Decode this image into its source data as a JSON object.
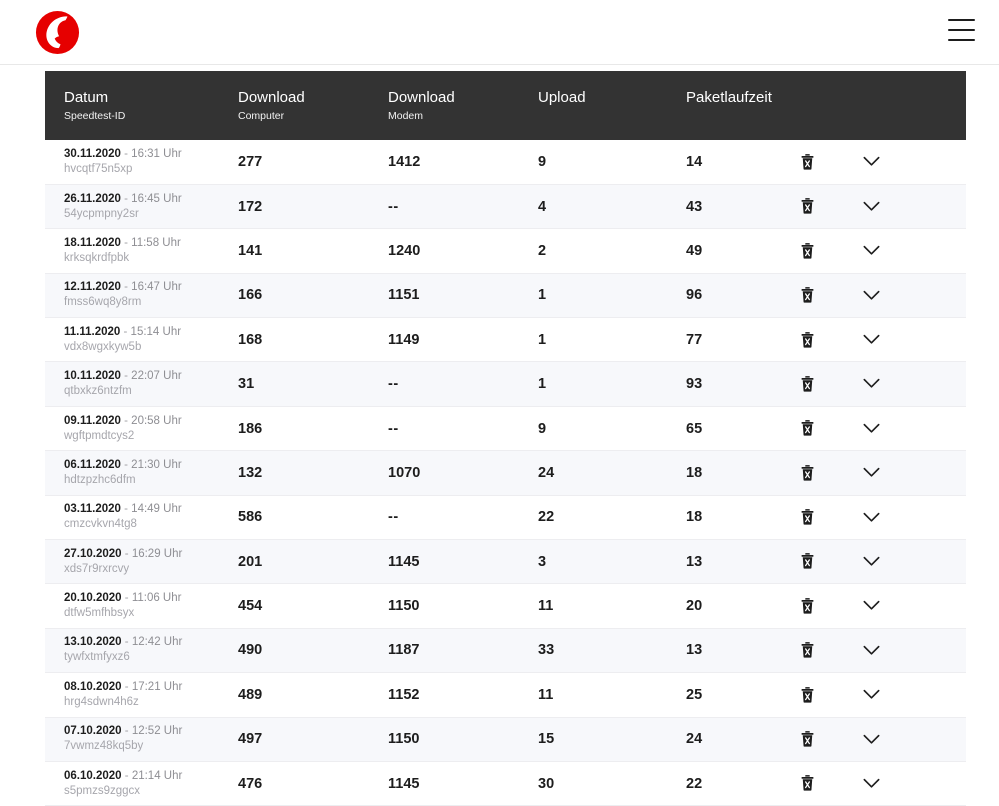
{
  "header": {
    "logo_name": "vodafone-logo",
    "logo_color": "#e60000",
    "menu_label": "menu"
  },
  "table": {
    "columns": [
      {
        "title": "Datum",
        "sub": "Speedtest-ID"
      },
      {
        "title": "Download",
        "sub": "Computer"
      },
      {
        "title": "Download",
        "sub": "Modem"
      },
      {
        "title": "Upload",
        "sub": ""
      },
      {
        "title": "Paketlaufzeit",
        "sub": ""
      },
      {
        "title": "",
        "sub": ""
      }
    ],
    "header_bg": "#333333",
    "row_alt_bg": "#f7f8fb",
    "rows": [
      {
        "date": "30.11.2020",
        "sep": "-",
        "time": "16:31 Uhr",
        "id": "hvcqtf75n5xp",
        "download_computer": "277",
        "download_modem": "1412",
        "upload": "9",
        "paketlaufzeit": "14"
      },
      {
        "date": "26.11.2020",
        "sep": "-",
        "time": "16:45 Uhr",
        "id": "54ycpmpny2sr",
        "download_computer": "172",
        "download_modem": "--",
        "upload": "4",
        "paketlaufzeit": "43"
      },
      {
        "date": "18.11.2020",
        "sep": "-",
        "time": "11:58 Uhr",
        "id": "krksqkrdfpbk",
        "download_computer": "141",
        "download_modem": "1240",
        "upload": "2",
        "paketlaufzeit": "49"
      },
      {
        "date": "12.11.2020",
        "sep": "-",
        "time": "16:47 Uhr",
        "id": "fmss6wq8y8rm",
        "download_computer": "166",
        "download_modem": "1151",
        "upload": "1",
        "paketlaufzeit": "96"
      },
      {
        "date": "11.11.2020",
        "sep": "-",
        "time": "15:14 Uhr",
        "id": "vdx8wgxkyw5b",
        "download_computer": "168",
        "download_modem": "1149",
        "upload": "1",
        "paketlaufzeit": "77"
      },
      {
        "date": "10.11.2020",
        "sep": "-",
        "time": "22:07 Uhr",
        "id": "qtbxkz6ntzfm",
        "download_computer": "31",
        "download_modem": "--",
        "upload": "1",
        "paketlaufzeit": "93"
      },
      {
        "date": "09.11.2020",
        "sep": "-",
        "time": "20:58 Uhr",
        "id": "wgftpmdtcys2",
        "download_computer": "186",
        "download_modem": "--",
        "upload": "9",
        "paketlaufzeit": "65"
      },
      {
        "date": "06.11.2020",
        "sep": "-",
        "time": "21:30 Uhr",
        "id": "hdtzpzhc6dfm",
        "download_computer": "132",
        "download_modem": "1070",
        "upload": "24",
        "paketlaufzeit": "18"
      },
      {
        "date": "03.11.2020",
        "sep": "-",
        "time": "14:49 Uhr",
        "id": "cmzcvkvn4tg8",
        "download_computer": "586",
        "download_modem": "--",
        "upload": "22",
        "paketlaufzeit": "18"
      },
      {
        "date": "27.10.2020",
        "sep": "-",
        "time": "16:29 Uhr",
        "id": "xds7r9rxrcvy",
        "download_computer": "201",
        "download_modem": "1145",
        "upload": "3",
        "paketlaufzeit": "13"
      },
      {
        "date": "20.10.2020",
        "sep": "-",
        "time": "11:06 Uhr",
        "id": "dtfw5mfhbsyx",
        "download_computer": "454",
        "download_modem": "1150",
        "upload": "11",
        "paketlaufzeit": "20"
      },
      {
        "date": "13.10.2020",
        "sep": "-",
        "time": "12:42 Uhr",
        "id": "tywfxtmfyxz6",
        "download_computer": "490",
        "download_modem": "1187",
        "upload": "33",
        "paketlaufzeit": "13"
      },
      {
        "date": "08.10.2020",
        "sep": "-",
        "time": "17:21 Uhr",
        "id": "hrg4sdwn4h6z",
        "download_computer": "489",
        "download_modem": "1152",
        "upload": "11",
        "paketlaufzeit": "25"
      },
      {
        "date": "07.10.2020",
        "sep": "-",
        "time": "12:52 Uhr",
        "id": "7vwmz48kq5by",
        "download_computer": "497",
        "download_modem": "1150",
        "upload": "15",
        "paketlaufzeit": "24"
      },
      {
        "date": "06.10.2020",
        "sep": "-",
        "time": "21:14 Uhr",
        "id": "s5pmzs9zggcx",
        "download_computer": "476",
        "download_modem": "1145",
        "upload": "30",
        "paketlaufzeit": "22"
      }
    ],
    "row_actions": {
      "delete_icon": "trash-icon",
      "expand_icon": "chevron-down-icon"
    }
  }
}
